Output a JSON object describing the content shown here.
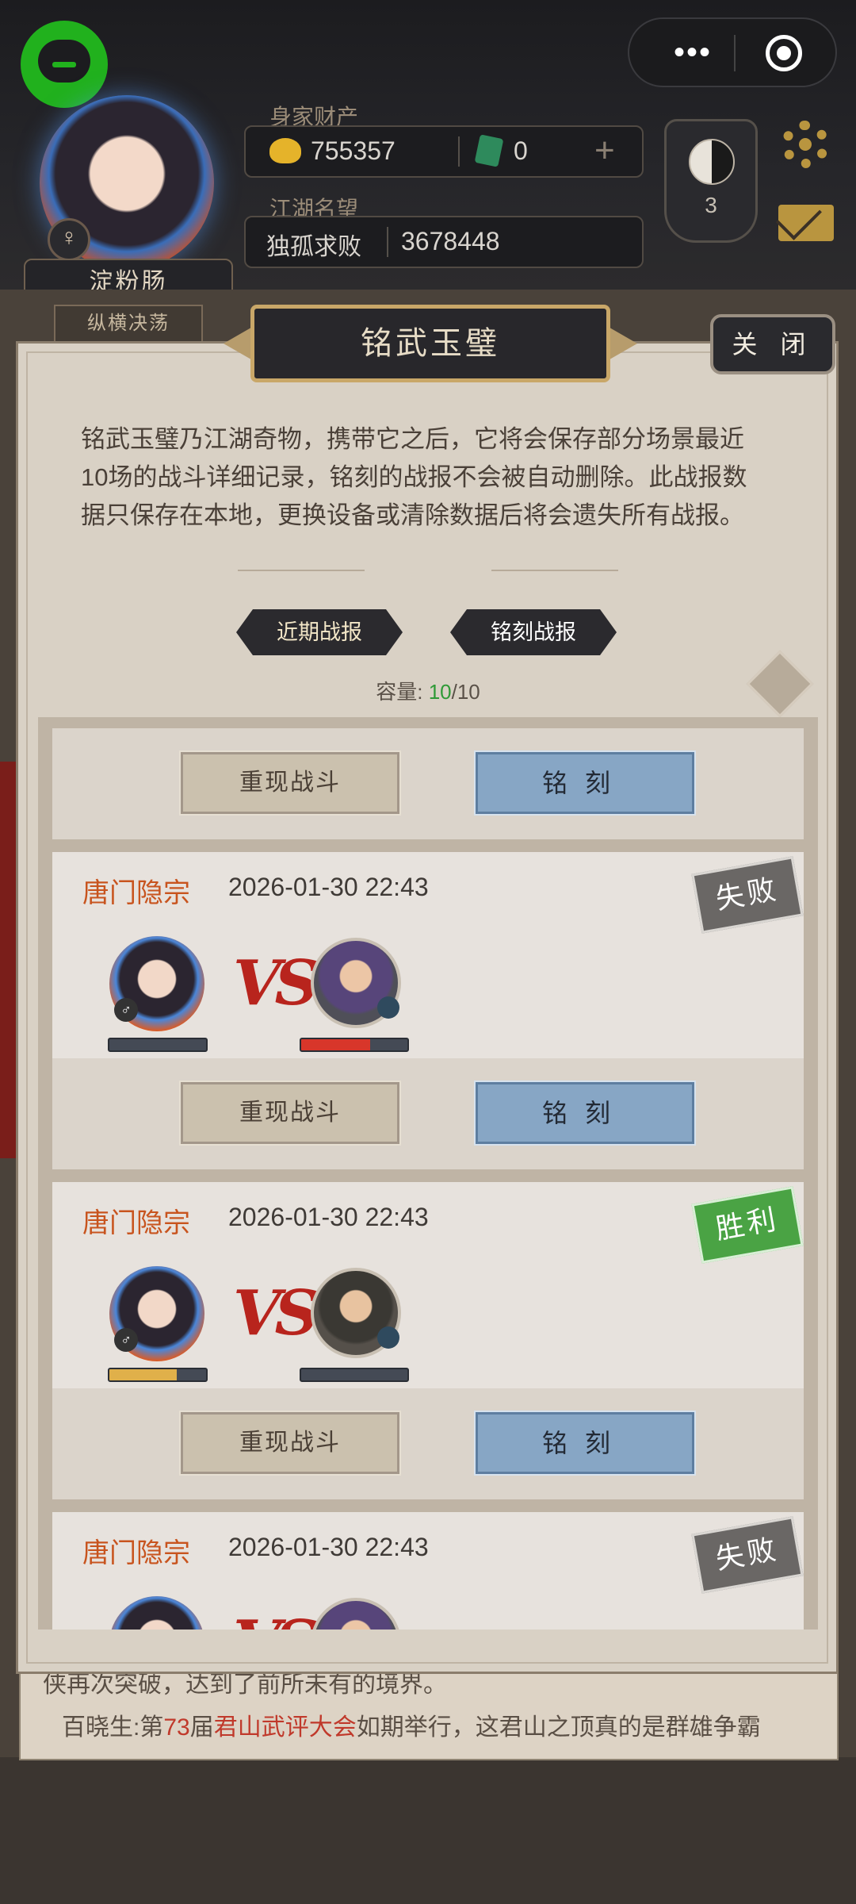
{
  "header": {
    "player_name": "淀粉肠",
    "player_title": "纵横决荡",
    "gender_symbol": "♀",
    "wealth_label": "身家财产",
    "gold": "755357",
    "jade": "0",
    "reputation_label": "江湖名望",
    "reputation_title": "独孤求败",
    "reputation_value": "3678448",
    "taiji_level": "3",
    "capsule_more": "•••"
  },
  "modal": {
    "title": "铭武玉璧",
    "close_label": "关 闭",
    "description": "铭武玉璧乃江湖奇物，携带它之后，它将会保存部分场景最近10场的战斗详细记录，铭刻的战报不会被自动删除。此战报数据只保存在本地，更换设备或清除数据后将会遗失所有战报。",
    "tabs": [
      "近期战报",
      "铭刻战报"
    ],
    "capacity_label": "容量:",
    "capacity_used": "10",
    "capacity_total": "/10",
    "replay_label": "重现战斗",
    "engrave_label": "铭刻",
    "vs_text": "VS"
  },
  "records": [
    {
      "sect": "唐门隐宗",
      "time": "2026-01-30 22:43",
      "result": "失败",
      "result_type": "lose",
      "self_hp": 0.0,
      "opp_hp": 0.65,
      "self_hp_color": "#e0b04a",
      "opp_hp_color": "#d8362a"
    },
    {
      "sect": "唐门隐宗",
      "time": "2026-01-30 22:43",
      "result": "胜利",
      "result_type": "win",
      "self_hp": 0.7,
      "opp_hp": 0.0,
      "self_hp_color": "#e0b04a",
      "opp_hp_color": "#d8362a"
    },
    {
      "sect": "唐门隐宗",
      "time": "2026-01-30 22:43",
      "result": "失败",
      "result_type": "lose",
      "self_hp": 0.0,
      "opp_hp": 0.0,
      "self_hp_color": "#e0b04a",
      "opp_hp_color": "#d8362a"
    }
  ],
  "news": {
    "line1": "侠再次突破，达到了前所未有的境界。",
    "line2_prefix": "百晓生:第",
    "line2_number": "73",
    "line2_mid": "届",
    "line2_event": "君山武评大会",
    "line2_suffix": "如期举行，这君山之顶真的是群雄争霸"
  },
  "colors": {
    "accent_gold": "#c9a768",
    "win_green": "#4aa344",
    "lose_gray": "#6a6765",
    "sect_orange": "#c8541e",
    "engrave_blue": "#87a6c5"
  }
}
